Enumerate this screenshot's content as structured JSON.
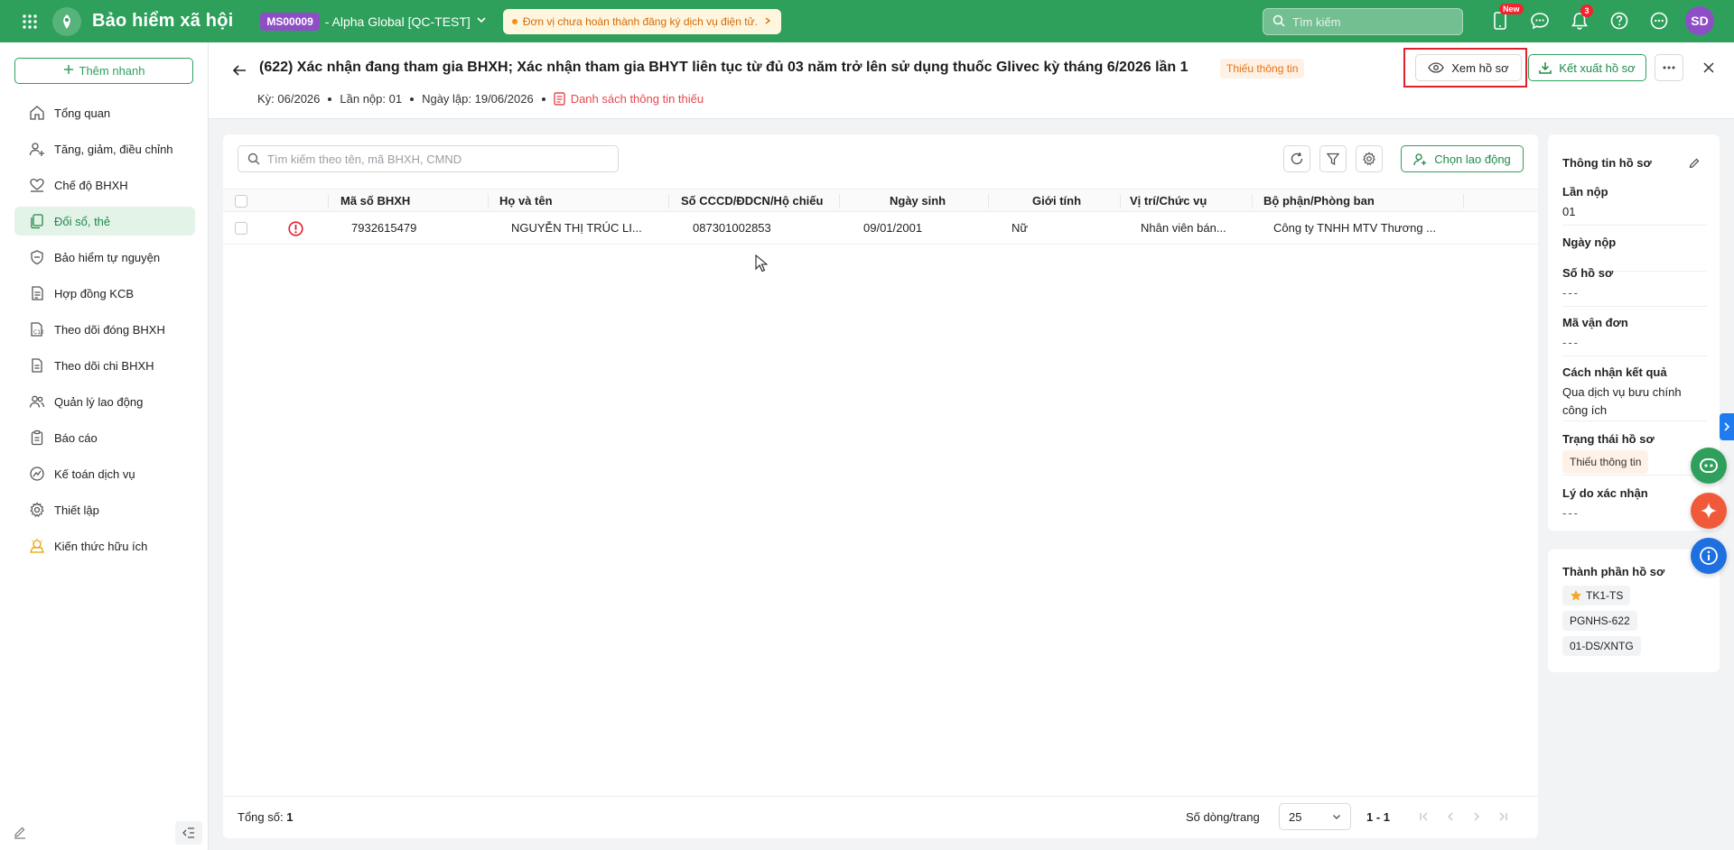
{
  "topbar": {
    "app_title": "Bảo hiểm xã hội",
    "org_code": "MS00009",
    "org_name": "- Alpha Global [QC-TEST]",
    "notice": "Đơn vị chưa hoàn thành đăng ký dịch vụ điện tử.",
    "search_placeholder": "Tìm kiếm",
    "new_badge": "New",
    "notification_count": "3",
    "avatar_initials": "SD",
    "brand_color": "#2ea05b"
  },
  "sidebar": {
    "quick_add": "Thêm nhanh",
    "items": [
      {
        "label": "Tổng quan",
        "icon": "home-icon"
      },
      {
        "label": "Tăng, giảm, điều chỉnh",
        "icon": "user-plus-icon"
      },
      {
        "label": "Chế độ BHXH",
        "icon": "heart-hand-icon"
      },
      {
        "label": "Đổi sổ, thẻ",
        "icon": "copy-icon",
        "active": true
      },
      {
        "label": "Bảo hiểm tự nguyện",
        "icon": "shield-icon"
      },
      {
        "label": "Hợp đồng KCB",
        "icon": "contract-icon"
      },
      {
        "label": "Theo dõi đóng BHXH",
        "icon": "c12-report-icon"
      },
      {
        "label": "Theo dõi chi BHXH",
        "icon": "document-icon"
      },
      {
        "label": "Quản lý lao động",
        "icon": "users-icon"
      },
      {
        "label": "Báo cáo",
        "icon": "clipboard-icon"
      },
      {
        "label": "Kế toán dịch vụ",
        "icon": "accounting-icon"
      },
      {
        "label": "Thiết lập",
        "icon": "gear-icon"
      },
      {
        "label": "Kiến thức hữu ích",
        "icon": "knowledge-icon"
      }
    ]
  },
  "header": {
    "title": "(622) Xác nhận đang tham gia BHXH; Xác nhận tham gia BHYT liên tục từ đủ 03 năm trở lên sử dụng thuốc Glivec kỳ tháng 6/2026 lần 1",
    "status": "Thiếu thông tin",
    "period": "Kỳ: 06/2026",
    "submission": "Lần nộp: 01",
    "created": "Ngày lập: 19/06/2026",
    "missing_list": "Danh sách thông tin thiếu",
    "view_button": "Xem hồ sơ",
    "export_button": "Kết xuất hồ sơ"
  },
  "table": {
    "search_placeholder": "Tìm kiếm theo tên, mã BHXH, CMND",
    "choose_button": "Chọn lao động",
    "columns": [
      "Mã số BHXH",
      "Họ và tên",
      "Số CCCD/ĐDCN/Hộ chiếu",
      "Ngày sinh",
      "Giới tính",
      "Vị trí/Chức vụ",
      "Bộ phận/Phòng ban"
    ],
    "rows": [
      {
        "social_insurance_no": "7932615479",
        "full_name": "NGUYỄN THỊ TRÚC LI...",
        "id_no": "087301002853",
        "dob": "09/01/2001",
        "gender": "Nữ",
        "position": "Nhân viên bán...",
        "department": "Công ty TNHH MTV Thương ..."
      }
    ],
    "total_label": "Tổng số:",
    "total_value": "1",
    "rows_per_page_label": "Số dòng/trang",
    "rows_per_page": "25",
    "range": "1 - 1"
  },
  "info_panel": {
    "title": "Thông tin hồ sơ",
    "fields": [
      {
        "label": "Lần nộp",
        "value": "01"
      },
      {
        "label": "Ngày nộp",
        "value": ""
      },
      {
        "label": "Số hồ sơ",
        "value": "---"
      },
      {
        "label": "Mã vận đơn",
        "value": "---"
      },
      {
        "label": "Cách nhận kết quả",
        "value": "Qua dịch vụ bưu chính công ích"
      },
      {
        "label": "Trạng thái hồ sơ",
        "value": "Thiếu thông tin"
      },
      {
        "label": "Lý do xác nhận",
        "value": "---"
      }
    ]
  },
  "components_panel": {
    "title": "Thành phần hồ sơ",
    "chips": [
      "TK1-TS",
      "PGNHS-622",
      "01-DS/XNTG"
    ]
  }
}
